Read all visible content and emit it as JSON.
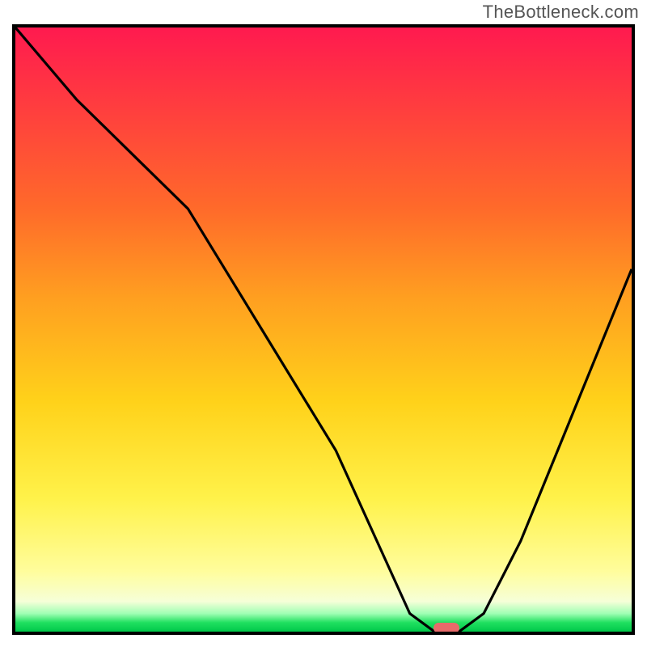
{
  "domain": "Chart",
  "watermark": "TheBottleneck.com",
  "chart_data": {
    "type": "line",
    "title": "",
    "xlabel": "",
    "ylabel": "",
    "xlim": [
      0,
      100
    ],
    "ylim": [
      0,
      100
    ],
    "grid": false,
    "legend": false,
    "background_gradient": {
      "orientation": "vertical",
      "stops": [
        {
          "pos": 0,
          "color": "#ff1a4f"
        },
        {
          "pos": 30,
          "color": "#ff6a2a"
        },
        {
          "pos": 62,
          "color": "#ffd21a"
        },
        {
          "pos": 90,
          "color": "#fffd9c"
        },
        {
          "pos": 97,
          "color": "#a0ffb4"
        },
        {
          "pos": 100,
          "color": "#00c84a"
        }
      ]
    },
    "series": [
      {
        "name": "bottleneck-curve",
        "color": "#000000",
        "x": [
          0,
          10,
          20,
          28,
          40,
          52,
          60,
          64,
          68,
          72,
          76,
          82,
          90,
          100
        ],
        "y": [
          100,
          88,
          78,
          70,
          50,
          30,
          12,
          3,
          0,
          0,
          3,
          15,
          35,
          60
        ]
      }
    ],
    "marker": {
      "name": "optimal-point-pill",
      "shape": "rounded-rect",
      "color": "#e86a6a",
      "x": 70,
      "y": 0
    }
  }
}
